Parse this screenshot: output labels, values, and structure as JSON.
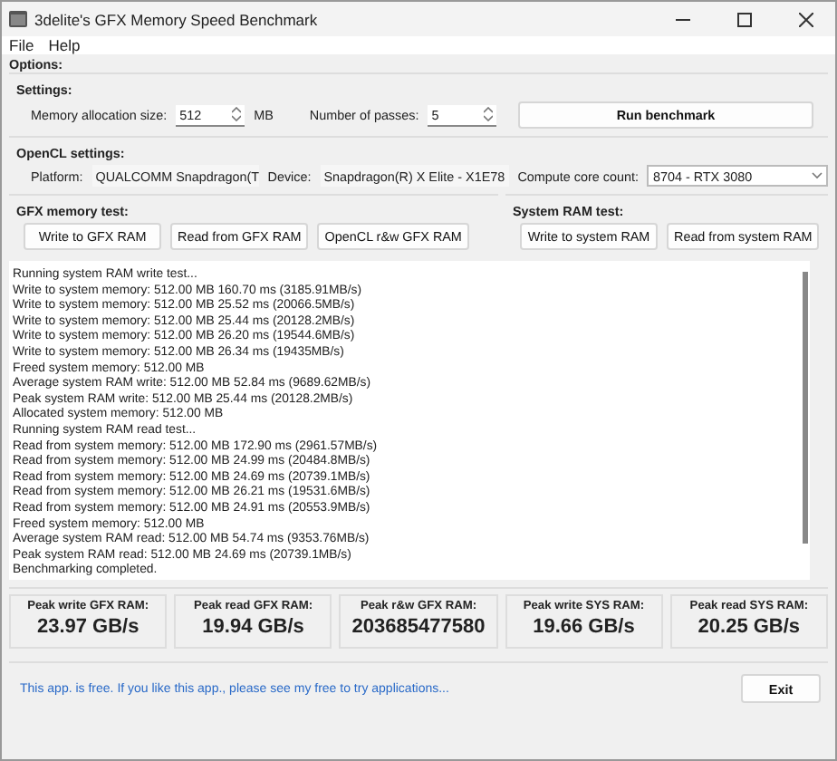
{
  "window": {
    "title": "3delite's GFX Memory Speed Benchmark"
  },
  "menu": [
    "File",
    "Help"
  ],
  "options_label": "Options:",
  "settings": {
    "title": "Settings:",
    "memory_label": "Memory allocation size:",
    "memory_value": "512",
    "memory_unit": "MB",
    "passes_label": "Number of passes:",
    "passes_value": "5",
    "run_button": "Run benchmark"
  },
  "opencl": {
    "title": "OpenCL settings:",
    "platform_label": "Platform:",
    "platform_value": "QUALCOMM Snapdragon(T",
    "device_label": "Device:",
    "device_value": "Snapdragon(R) X Elite - X1E78",
    "cores_label": "Compute core count:",
    "cores_value": "8704 - RTX 3080"
  },
  "gfx_test": {
    "title": "GFX memory test:",
    "buttons": [
      "Write to GFX RAM",
      "Read from GFX RAM",
      "OpenCL r&w GFX RAM"
    ]
  },
  "sys_test": {
    "title": "System RAM test:",
    "buttons": [
      "Write to system RAM",
      "Read from system RAM"
    ]
  },
  "log": [
    "Running system RAM write test...",
    "Write to system memory: 512.00 MB 160.70 ms (3185.91MB/s)",
    "Write to system memory: 512.00 MB 25.52 ms (20066.5MB/s)",
    "Write to system memory: 512.00 MB 25.44 ms (20128.2MB/s)",
    "Write to system memory: 512.00 MB 26.20 ms (19544.6MB/s)",
    "Write to system memory: 512.00 MB 26.34 ms (19435MB/s)",
    "Freed system memory: 512.00 MB",
    "Average system RAM write: 512.00 MB 52.84 ms (9689.62MB/s)",
    "Peak system RAM write: 512.00 MB 25.44 ms (20128.2MB/s)",
    "Allocated system memory: 512.00 MB",
    "Running system RAM read test...",
    "Read from system memory: 512.00 MB 172.90 ms (2961.57MB/s)",
    "Read from system memory: 512.00 MB 24.99 ms (20484.8MB/s)",
    "Read from system memory: 512.00 MB 24.69 ms (20739.1MB/s)",
    "Read from system memory: 512.00 MB 26.21 ms (19531.6MB/s)",
    "Read from system memory: 512.00 MB 24.91 ms (20553.9MB/s)",
    "Freed system memory: 512.00 MB",
    "Average system RAM read: 512.00 MB 54.74 ms (9353.76MB/s)",
    "Peak system RAM read: 512.00 MB 24.69 ms (20739.1MB/s)",
    "Benchmarking completed."
  ],
  "results": [
    {
      "label": "Peak write GFX RAM:",
      "value": "23.97 GB/s"
    },
    {
      "label": "Peak read GFX RAM:",
      "value": "19.94 GB/s"
    },
    {
      "label": "Peak r&w GFX RAM:",
      "value": "203685477580"
    },
    {
      "label": "Peak write SYS RAM:",
      "value": "19.66 GB/s"
    },
    {
      "label": "Peak read SYS RAM:",
      "value": "20.25 GB/s"
    }
  ],
  "footer": {
    "link": "This app. is free. If you like this app., please see my free to try applications...",
    "exit_button": "Exit"
  }
}
